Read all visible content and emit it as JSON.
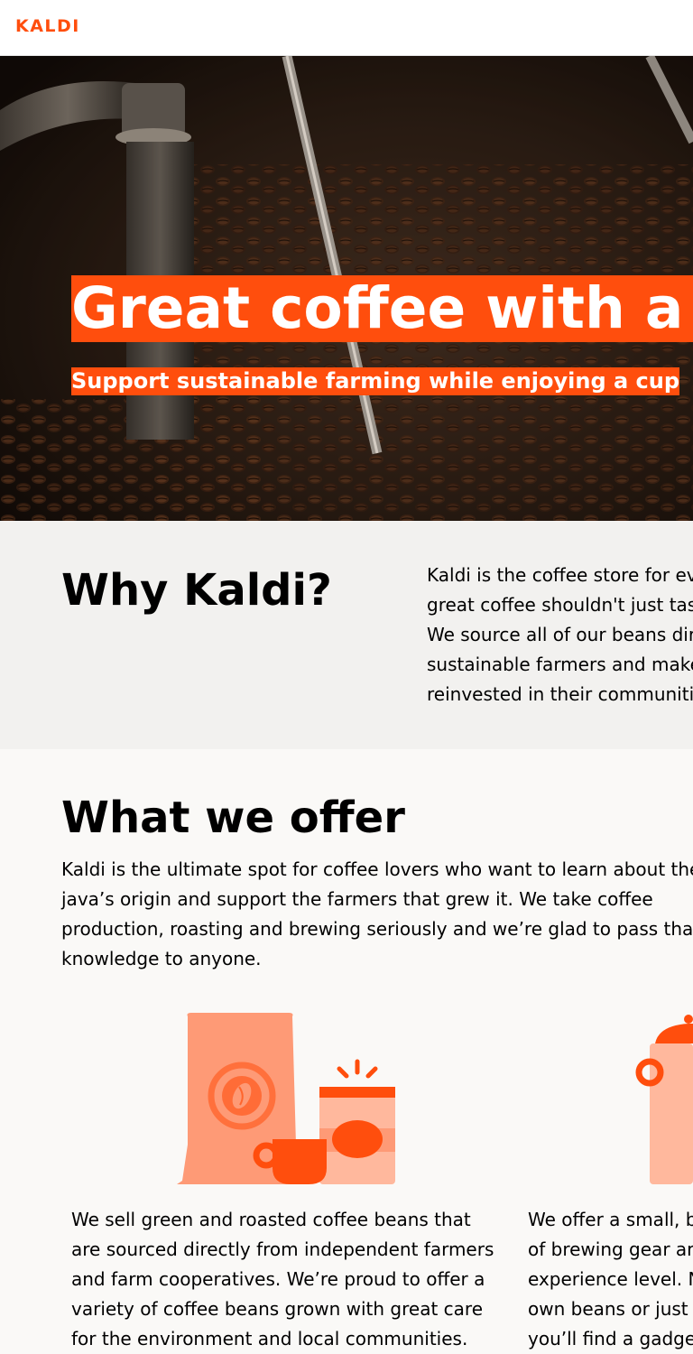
{
  "header": {
    "logo": "KALDI"
  },
  "hero": {
    "title": "Great coffee with a co",
    "subtitle": "Support sustainable farming while enjoying a cup"
  },
  "why": {
    "title": "Why Kaldi?",
    "lines": [
      "Kaldi is the coffee store for ev",
      "great coffee shouldn't just tas",
      "We source all of our beans dir",
      "sustainable farmers and make",
      "reinvested in their communiti"
    ]
  },
  "offer": {
    "title": "What we offer",
    "text": "Kaldi is the ultimate spot for coffee lovers who want to learn about their java’s origin and support the farmers that grew it. We take coffee production, roasting and brewing seriously and we’re glad to pass that knowledge to anyone.",
    "cards": [
      {
        "text": "We sell green and roasted coffee beans that are sourced directly from independent farmers and farm cooperatives. We’re proud to offer a variety of coffee beans grown with great care for the environment and local communities."
      },
      {
        "lines": [
          "We offer a small, b",
          "of brewing gear ar",
          "experience level. N",
          "own beans or just l",
          "you’ll find a gadge"
        ]
      }
    ]
  },
  "colors": {
    "accent": "#ff4e0d",
    "accent_light": "#fe9a76",
    "accent_pale": "#ffb89d"
  }
}
